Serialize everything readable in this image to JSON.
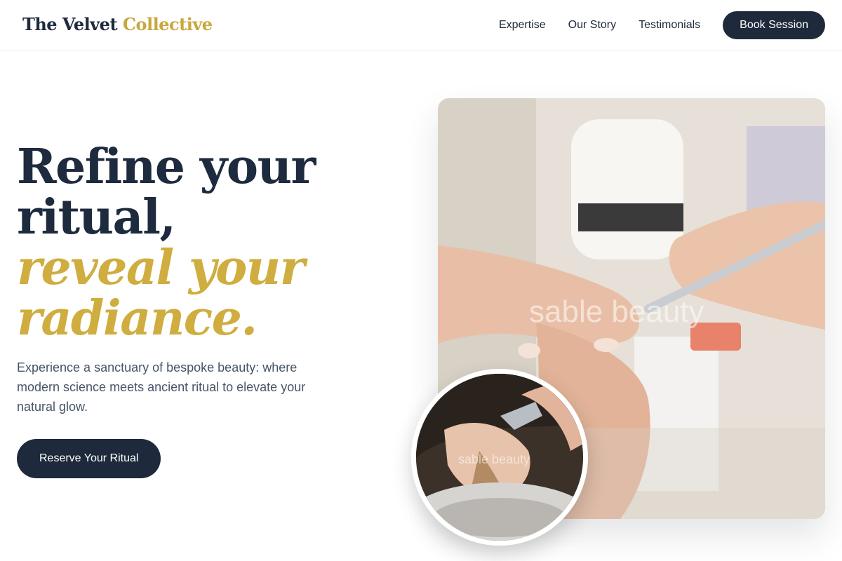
{
  "brand": {
    "name_part1": "The Velvet",
    "name_part2": "Collective"
  },
  "nav": {
    "links": [
      "Expertise",
      "Our Story",
      "Testimonials"
    ],
    "cta": "Book Session"
  },
  "hero": {
    "headline_line1": "Refine your",
    "headline_line2": "ritual,",
    "headline_line3": "reveal your",
    "headline_line4": "radiance.",
    "lead": "Experience a sanctuary of bespoke beauty: where modern science meets ancient ritual to elevate your natural glow.",
    "cta": "Reserve Your Ritual"
  },
  "images": {
    "main_watermark": "sable beauty",
    "circle_watermark": "sable beauty"
  },
  "colors": {
    "navy": "#1e293b",
    "gold": "#cfad3f"
  }
}
